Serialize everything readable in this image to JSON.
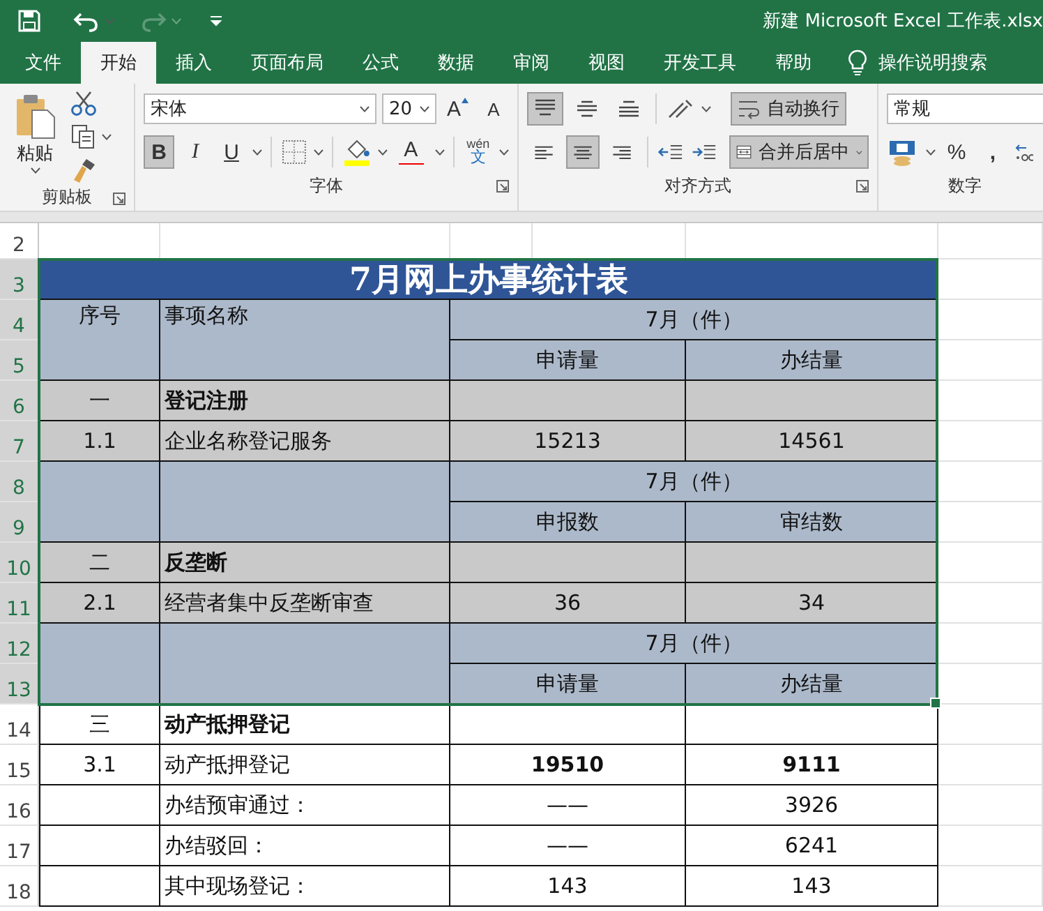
{
  "title_bar": {
    "file_title": "新建 Microsoft Excel 工作表.xlsx",
    "redo_disabled": true
  },
  "ribbon_tabs": [
    {
      "label": "文件",
      "selected": false
    },
    {
      "label": "开始",
      "selected": true
    },
    {
      "label": "插入",
      "selected": false
    },
    {
      "label": "页面布局",
      "selected": false
    },
    {
      "label": "公式",
      "selected": false
    },
    {
      "label": "数据",
      "selected": false
    },
    {
      "label": "审阅",
      "selected": false
    },
    {
      "label": "视图",
      "selected": false
    },
    {
      "label": "开发工具",
      "selected": false
    },
    {
      "label": "帮助",
      "selected": false
    }
  ],
  "search_label": "操作说明搜索",
  "clipboard": {
    "paste": "粘贴",
    "group": "剪贴板"
  },
  "font": {
    "name": "宋体",
    "size": "20",
    "grow": "A",
    "shrink": "A",
    "bold": {
      "label": "B",
      "selected": true
    },
    "italic": "I",
    "underline": "U",
    "font_color": "A",
    "phonetic_top": "wén",
    "phonetic_bottom": "文",
    "group": "字体"
  },
  "alignment": {
    "vertical": [
      {
        "kind": "top",
        "selected": true
      },
      {
        "kind": "middle",
        "selected": false
      },
      {
        "kind": "bottom",
        "selected": false
      }
    ],
    "horizontal": [
      {
        "kind": "left",
        "selected": false
      },
      {
        "kind": "center",
        "selected": true
      },
      {
        "kind": "right",
        "selected": false
      }
    ],
    "wrap": {
      "label": "自动换行",
      "on": true
    },
    "merge": {
      "label": "合并后居中",
      "on": true
    },
    "group": "对齐方式"
  },
  "number": {
    "format": "常规",
    "percent": "%",
    "comma": ",",
    "group": "数字"
  },
  "sheet": {
    "blocks": [
      {
        "kind": "blank",
        "rows": [
          "2"
        ],
        "selected": false
      },
      {
        "kind": "title",
        "rows": [
          "3"
        ],
        "selected": true,
        "text": "7月网上办事统计表"
      },
      {
        "kind": "header",
        "rows": [
          "4",
          "5"
        ],
        "selected": true,
        "index": "序号",
        "name": "事项名称",
        "group": "7月（件）",
        "columns": [
          "申请量",
          "办结量"
        ]
      },
      {
        "kind": "section",
        "rows": [
          "6"
        ],
        "selected": true,
        "index": "一",
        "name": "登记注册"
      },
      {
        "kind": "item",
        "rows": [
          "7"
        ],
        "selected": true,
        "index": "1.1",
        "name": "企业名称登记服务",
        "values": [
          "15213",
          "14561"
        ],
        "bold_values": false
      },
      {
        "kind": "header",
        "rows": [
          "8",
          "9"
        ],
        "selected": true,
        "group": "7月（件）",
        "columns": [
          "申报数",
          "审结数"
        ]
      },
      {
        "kind": "section",
        "rows": [
          "10"
        ],
        "selected": true,
        "index": "二",
        "name": "反垄断"
      },
      {
        "kind": "item",
        "rows": [
          "11"
        ],
        "selected": true,
        "index": "2.1",
        "name": "经营者集中反垄断审查",
        "values": [
          "36",
          "34"
        ],
        "bold_values": false
      },
      {
        "kind": "header",
        "rows": [
          "12",
          "13"
        ],
        "selected": true,
        "group": "7月（件）",
        "columns": [
          "申请量",
          "办结量"
        ]
      },
      {
        "kind": "section",
        "rows": [
          "14"
        ],
        "selected": false,
        "index": "三",
        "name": "动产抵押登记"
      },
      {
        "kind": "item",
        "rows": [
          "15"
        ],
        "selected": false,
        "index": "3.1",
        "name": "动产抵押登记",
        "values": [
          "19510",
          "9111"
        ],
        "bold_values": true
      },
      {
        "kind": "item",
        "rows": [
          "16"
        ],
        "selected": false,
        "name": "办结预审通过：",
        "values": [
          "——",
          "3926"
        ],
        "bold_values": false
      },
      {
        "kind": "item",
        "rows": [
          "17"
        ],
        "selected": false,
        "name": "办结驳回：",
        "values": [
          "——",
          "6241"
        ],
        "bold_values": false
      },
      {
        "kind": "item",
        "rows": [
          "18"
        ],
        "selected": false,
        "name": "其中现场登记：",
        "values": [
          "143",
          "143"
        ],
        "bold_values": false
      }
    ]
  }
}
